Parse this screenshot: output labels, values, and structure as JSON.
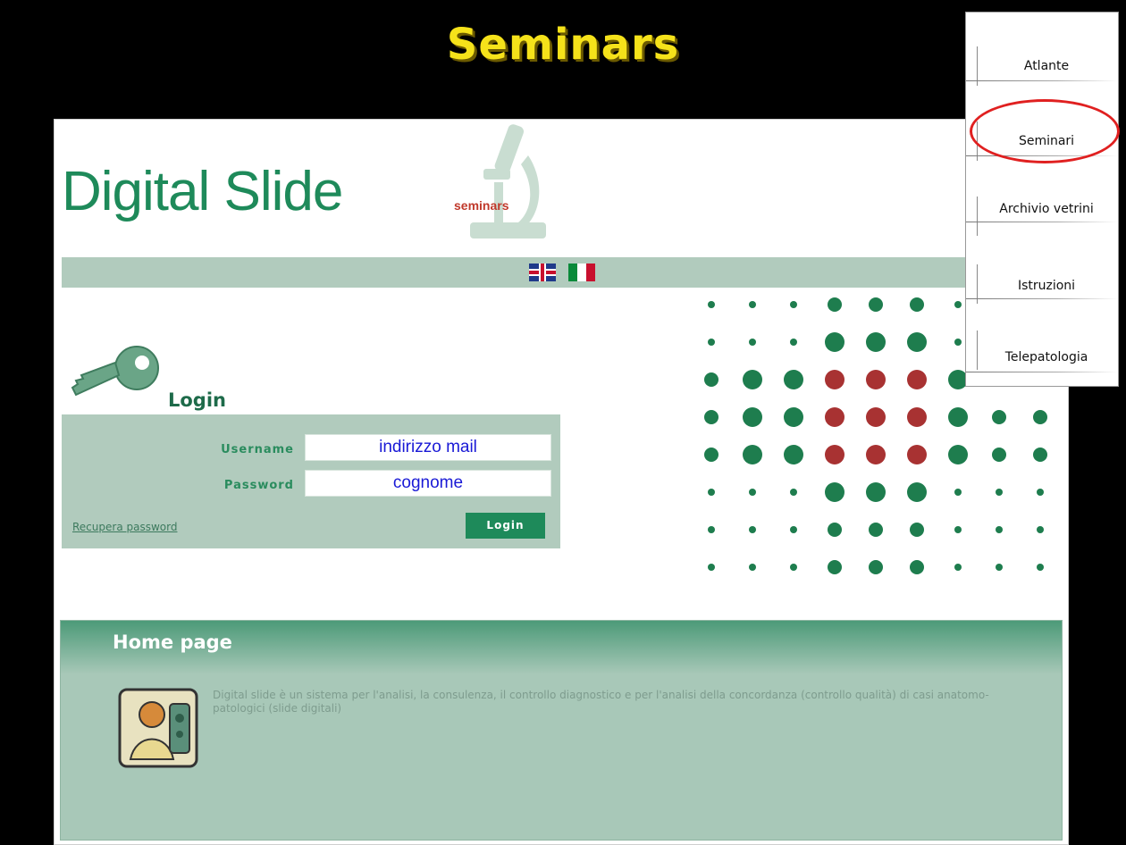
{
  "slide": {
    "title": "Seminars"
  },
  "site": {
    "logo_text": "Digital Slide",
    "logo_sub": "seminars"
  },
  "languages": [
    {
      "name": "uk-flag-icon"
    },
    {
      "name": "italy-flag-icon"
    }
  ],
  "login": {
    "heading": "Login",
    "username_label": "Username",
    "username_value": "indirizzo mail",
    "password_label": "Password",
    "password_value": "cognome",
    "recover_link": "Recupera password",
    "button_label": "Login"
  },
  "home": {
    "title": "Home page",
    "description": "Digital slide è un sistema per l'analisi, la consulenza, il controllo diagnostico e per l'analisi della concordanza (controllo qualità) di casi anatomo-patologici (slide digitali)"
  },
  "side_menu": {
    "items": [
      "Atlante",
      "Seminari",
      "Archivio vetrini",
      "Istruzioni",
      "Telepatologia"
    ],
    "highlighted": "Seminari"
  },
  "colors": {
    "brand_green": "#1e8a5a",
    "panel_green": "#b1cbbd",
    "title_yellow": "#f5e21a",
    "highlight_red": "#e02020"
  }
}
